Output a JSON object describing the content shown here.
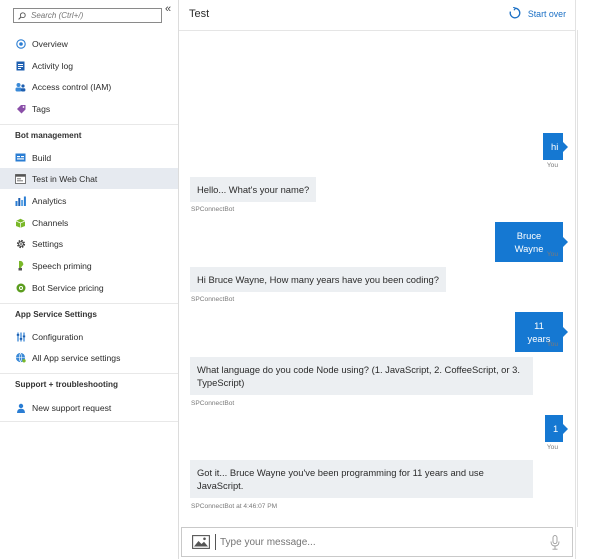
{
  "sidebar": {
    "search_placeholder": "Search (Ctrl+/)",
    "collapse_glyph": "«",
    "top_items": [
      {
        "label": "Overview",
        "icon": "overview-icon"
      },
      {
        "label": "Activity log",
        "icon": "activity-log-icon"
      },
      {
        "label": "Access control (IAM)",
        "icon": "access-control-icon"
      },
      {
        "label": "Tags",
        "icon": "tag-icon"
      }
    ],
    "section_bot": "Bot management",
    "bot_items": [
      {
        "label": "Build",
        "icon": "build-icon"
      },
      {
        "label": "Test in Web Chat",
        "icon": "web-chat-icon",
        "active": true
      },
      {
        "label": "Analytics",
        "icon": "analytics-icon"
      },
      {
        "label": "Channels",
        "icon": "channels-icon"
      },
      {
        "label": "Settings",
        "icon": "gear-icon"
      },
      {
        "label": "Speech priming",
        "icon": "speech-priming-icon"
      },
      {
        "label": "Bot Service pricing",
        "icon": "pricing-icon"
      }
    ],
    "section_app": "App Service Settings",
    "app_items": [
      {
        "label": "Configuration",
        "icon": "configuration-icon"
      },
      {
        "label": "All App service settings",
        "icon": "app-service-globe-icon"
      }
    ],
    "section_support": "Support + troubleshooting",
    "support_items": [
      {
        "label": "New support request",
        "icon": "support-request-icon"
      }
    ]
  },
  "chat": {
    "title": "Test",
    "start_over": "Start over",
    "messages": [
      {
        "from": "user",
        "text": "hi",
        "meta": "You"
      },
      {
        "from": "bot",
        "text": "Hello... What's your name?",
        "meta": "SPConnectBot"
      },
      {
        "from": "user",
        "text": "Bruce Wayne",
        "meta": "You"
      },
      {
        "from": "bot",
        "text": "Hi Bruce Wayne, How many years have you been coding?",
        "meta": "SPConnectBot"
      },
      {
        "from": "user",
        "text": "11 years",
        "meta": "You"
      },
      {
        "from": "bot",
        "text": "What language do you code Node using? (1. JavaScript, 2. CoffeeScript, or 3. TypeScript)",
        "meta": "SPConnectBot"
      },
      {
        "from": "user",
        "text": "1",
        "meta": "You"
      },
      {
        "from": "bot",
        "text": "Got it... Bruce Wayne you've been programming for 11 years and use JavaScript.",
        "meta": "SPConnectBot at 4:46:07 PM"
      }
    ],
    "input_placeholder": "Type your message..."
  },
  "colors": {
    "accent": "#1578d2",
    "bot_bubble": "#eceff2",
    "active_nav": "#e6eaf0",
    "link": "#1a6fc5"
  }
}
